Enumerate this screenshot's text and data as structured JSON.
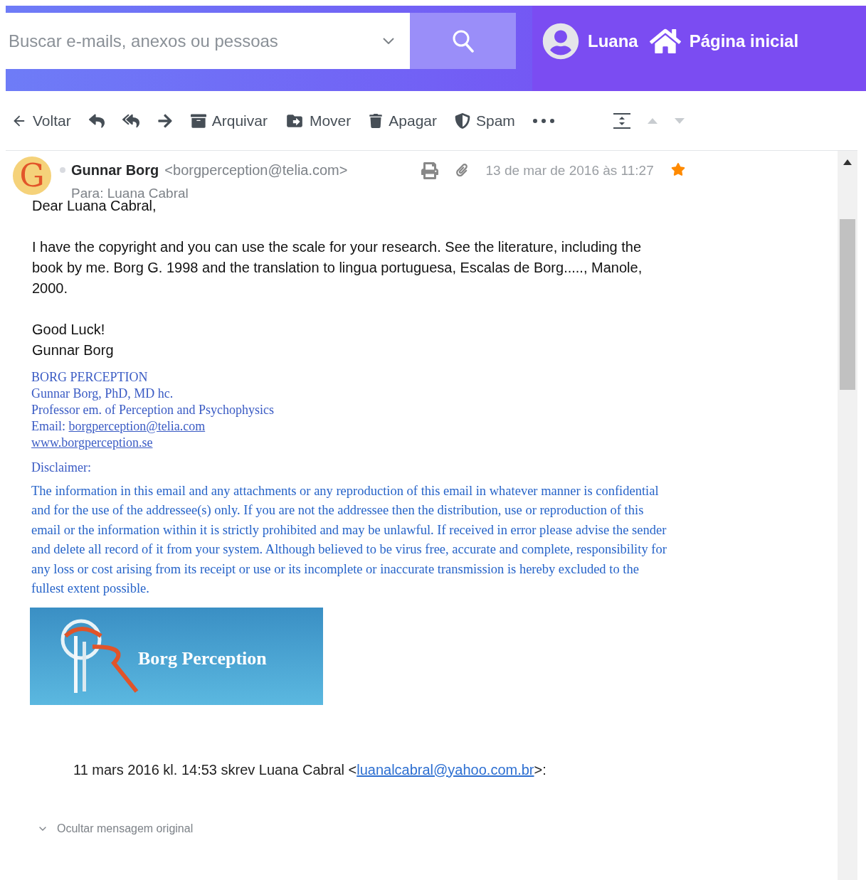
{
  "header": {
    "search": {
      "placeholder": "Buscar e-mails, anexos ou pessoas"
    },
    "user": {
      "name": "Luana"
    },
    "home": {
      "label": "Página inicial"
    }
  },
  "toolbar": {
    "items": [
      {
        "kind": "back",
        "label": "Voltar"
      },
      {
        "kind": "reply"
      },
      {
        "kind": "reply_all"
      },
      {
        "kind": "forward"
      },
      {
        "kind": "archive",
        "label": "Arquivar"
      },
      {
        "kind": "move",
        "label": "Mover"
      },
      {
        "kind": "delete",
        "label": "Apagar"
      },
      {
        "kind": "spam",
        "label": "Spam"
      },
      {
        "kind": "more"
      }
    ],
    "nav": [
      {
        "kind": "expand",
        "disabled": false
      },
      {
        "kind": "up",
        "disabled": true
      },
      {
        "kind": "down",
        "disabled": true
      }
    ]
  },
  "message": {
    "avatar_letter": "G",
    "sender": "Gunnar Borg",
    "sender_email": "<borgperception@telia.com>",
    "to_label": "Para:",
    "to": "Luana Cabral",
    "date": "13 de mar de 2016 às 11:27",
    "starred": true,
    "body": [
      "Dear Luana Cabral,",
      "I have the copyright and you can use the scale for your research. See the literature, including the book by me. Borg G. 1998 and the translation to lingua portuguesa, Escalas de Borg....., Manole, 2000."
    ],
    "closing": [
      "Good Luck!",
      "Gunnar Borg"
    ],
    "signature": [
      {
        "text": "BORG PERCEPTION"
      },
      {
        "text": "Gunnar Borg, PhD, MD hc."
      },
      {
        "text": "Professor em. of Perception and Psychophysics"
      },
      {
        "text": "Email: ",
        "link": "borgperception@telia.com"
      },
      {
        "link": "www.borgperception.se"
      }
    ],
    "disclaimer_label": "Disclaimer:",
    "disclaimer": "The information in this email and any attachments or any reproduction of this email in whatever manner is confidential and for the use of the addressee(s) only. If you are not the addressee then the distribution, use or reproduction of this email or the information within it is strictly prohibited and may be unlawful. If received in error please advise the sender and delete all record of it from your system. Although believed to be virus free, accurate and complete, responsibility for any loss or cost arising from its receipt or use or its incomplete or inaccurate transmission is hereby excluded to the fullest extent possible.",
    "banner": {
      "text": "Borg Perception"
    },
    "quote": {
      "text": "11 mars 2016 kl. 14:53 skrev Luana Cabral <",
      "link": "luanalcabral@yahoo.com.br",
      "after": ">:"
    },
    "toggle": {
      "label": "Ocultar mensagem original",
      "expanded": true
    }
  }
}
